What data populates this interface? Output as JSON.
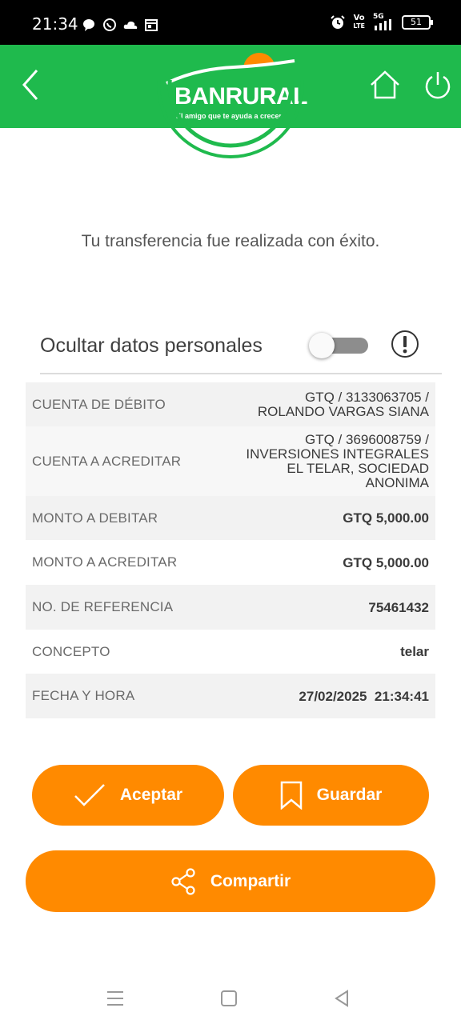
{
  "status_bar": {
    "time": "21:34",
    "battery": "51",
    "net_label_top": "Vo",
    "net_label_bottom": "LTE",
    "signal_label": "5G"
  },
  "header": {
    "logo_text": "BANRURAL",
    "logo_tagline": "El amigo que te ayuda a crecer",
    "icons": [
      "back-icon",
      "home-icon",
      "power-icon"
    ],
    "brand_color": "#1fba4d"
  },
  "success_message": "Tu transferencia fue realizada con éxito.",
  "privacy": {
    "label": "Ocultar datos personales",
    "toggle_on": false
  },
  "details": [
    {
      "label": "CUENTA DE DÉBITO",
      "value": [
        "GTQ / 3133063705 /",
        "ROLANDO VARGAS SIANA"
      ],
      "bold": false
    },
    {
      "label": "CUENTA A ACREDITAR",
      "value": [
        "GTQ / 3696008759 /",
        "INVERSIONES INTEGRALES",
        "EL TELAR, SOCIEDAD",
        "ANONIMA"
      ],
      "bold": false
    },
    {
      "label": "MONTO A DEBITAR",
      "value": [
        "GTQ 5,000.00"
      ],
      "bold": true
    },
    {
      "label": "MONTO A ACREDITAR",
      "value": [
        "GTQ 5,000.00"
      ],
      "bold": true
    },
    {
      "label": "NO. DE REFERENCIA",
      "value": [
        "75461432"
      ],
      "bold": true
    },
    {
      "label": "CONCEPTO",
      "value": [
        "telar"
      ],
      "bold": true
    },
    {
      "label": "FECHA Y HORA",
      "value": [
        "27/02/2025  21:34:41"
      ],
      "bold": true
    }
  ],
  "buttons": {
    "accept": "Aceptar",
    "save": "Guardar",
    "share": "Compartir",
    "color": "#ff8a00"
  },
  "nav": [
    "menu-icon",
    "home-square-icon",
    "back-triangle-icon"
  ]
}
